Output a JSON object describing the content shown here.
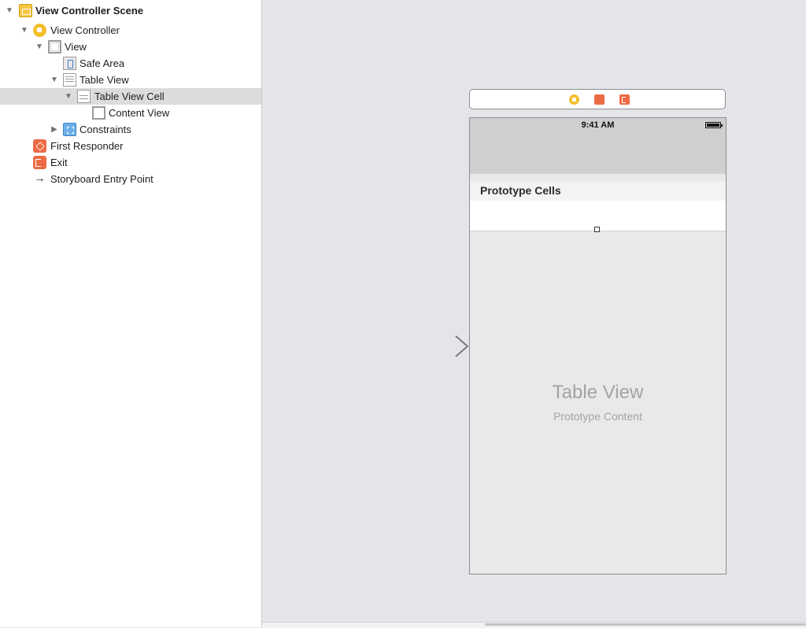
{
  "outline": {
    "items": [
      {
        "label": "View Controller Scene",
        "disclosure": "▼",
        "icon": "scene-icon"
      },
      {
        "label": "View Controller",
        "disclosure": "▼",
        "icon": "view-controller-icon"
      },
      {
        "label": "View",
        "disclosure": "▼",
        "icon": "view-icon"
      },
      {
        "label": "Safe Area",
        "icon": "safe-area-icon"
      },
      {
        "label": "Table View",
        "disclosure": "▼",
        "icon": "table-view-icon"
      },
      {
        "label": "Table View Cell",
        "disclosure": "▼",
        "icon": "table-view-cell-icon"
      },
      {
        "label": "Content View",
        "icon": "content-view-icon"
      },
      {
        "label": "Constraints",
        "disclosure": "▶",
        "icon": "constraints-icon"
      },
      {
        "label": "First Responder",
        "icon": "first-responder-icon"
      },
      {
        "label": "Exit",
        "icon": "exit-icon"
      },
      {
        "label": "Storyboard Entry Point",
        "icon": "arrow-right-icon",
        "glyph": "→"
      }
    ]
  },
  "canvas": {
    "status_time": "9:41 AM",
    "prototype_header": "Prototype Cells",
    "table_view_title": "Table View",
    "table_view_subtitle": "Prototype Content"
  },
  "colors": {
    "selection": "#dcdcdc",
    "view_controller_yellow": "#f5bf2c",
    "responder_orange": "#ec6b45",
    "constraints_blue": "#6cb0e8"
  }
}
